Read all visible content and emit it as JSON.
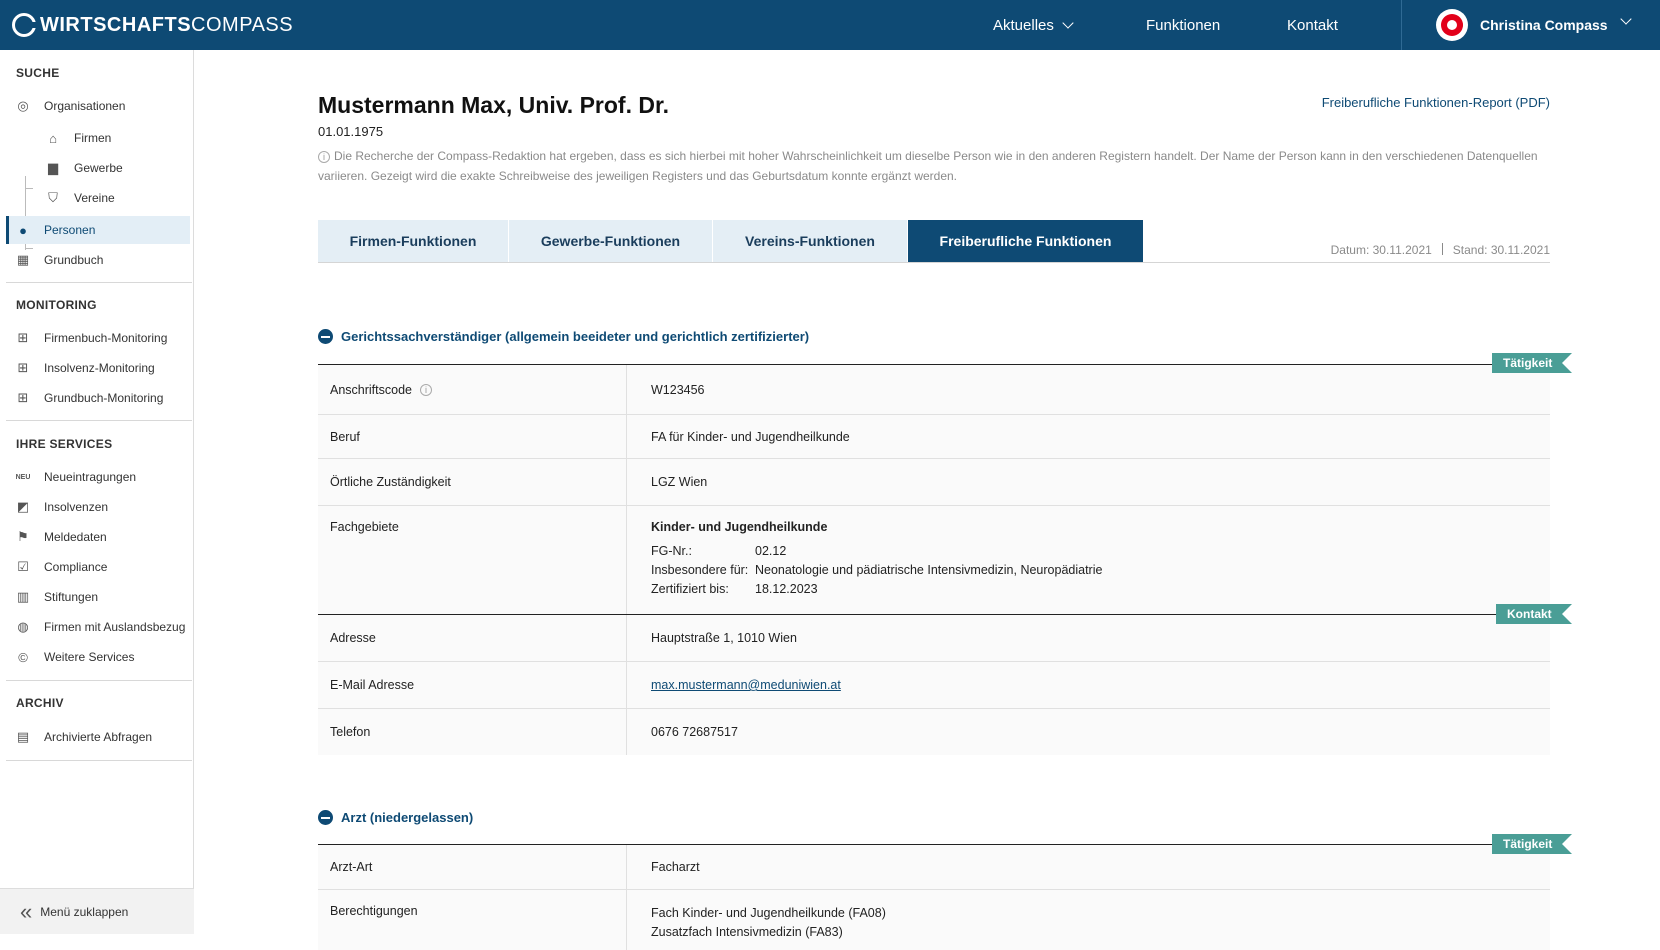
{
  "header": {
    "logo_bold": "WIRTSCHAFTS",
    "logo_light": "COMPASS",
    "nav": [
      "Aktuelles",
      "Funktionen",
      "Kontakt"
    ],
    "user": "Christina Compass"
  },
  "sidebar": {
    "sections": {
      "suche": "SUCHE",
      "monitoring": "MONITORING",
      "services": "IHRE SERVICES",
      "archiv": "ARCHIV"
    },
    "suche_items": [
      "Organisationen",
      "Firmen",
      "Gewerbe",
      "Vereine",
      "Personen",
      "Grundbuch"
    ],
    "monitoring_items": [
      "Firmenbuch-Monitoring",
      "Insolvenz-Monitoring",
      "Grundbuch-Monitoring"
    ],
    "services_items": [
      "Neueintragungen",
      "Insolvenzen",
      "Meldedaten",
      "Compliance",
      "Stiftungen",
      "Firmen mit Auslandsbezug",
      "Weitere Services"
    ],
    "neu_badge": "NEU",
    "archiv_items": [
      "Archivierte Abfragen"
    ],
    "collapse": "Menü zuklappen"
  },
  "main": {
    "title": "Mustermann Max, Univ. Prof. Dr.",
    "dob": "01.01.1975",
    "pdf_link": "Freiberufliche Funktionen-Report (PDF)",
    "info": "Die Recherche der Compass-Redaktion hat ergeben, dass es sich hierbei mit hoher Wahrscheinlichkeit um dieselbe Person wie in den anderen Registern handelt. Der Name der Person kann in den verschiedenen Datenquellen variieren. Gezeigt wird die exakte Schreibweise des jeweiligen Registers und das Geburtsdatum konnte ergänzt werden.",
    "tabs": [
      "Firmen-Funktionen",
      "Gewerbe-Funktionen",
      "Vereins-Funktionen",
      "Freiberufliche Funktionen"
    ],
    "datum": "Datum: 30.11.2021",
    "stand": "Stand: 30.11.2021"
  },
  "section1": {
    "title": "Gerichtssachverständiger (allgemein beeideter und gerichtlich zertifizierter)",
    "ribbon_taetigkeit": "Tätigkeit",
    "ribbon_kontakt": "Kontakt",
    "anschriftscode_label": "Anschriftscode",
    "anschriftscode": "W123456",
    "beruf_label": "Beruf",
    "beruf": "FA für Kinder- und Jugendheilkunde",
    "zustaendigkeit_label": "Örtliche Zuständigkeit",
    "zustaendigkeit": "LGZ Wien",
    "fachgebiete_label": "Fachgebiete",
    "fg_title": "Kinder- und Jugendheilkunde",
    "fg_nr_label": "FG-Nr.:",
    "fg_nr": "02.12",
    "insbesondere_label": "Insbesondere für:",
    "insbesondere": "Neonatologie und pädiatrische Intensivmedizin, Neuropädiatrie",
    "zertifiziert_label": "Zertifiziert bis:",
    "zertifiziert": "18.12.2023",
    "adresse_label": "Adresse",
    "adresse": "Hauptstraße 1, 1010 Wien",
    "email_label": "E-Mail Adresse",
    "email": "max.mustermann@meduniwien.at",
    "telefon_label": "Telefon",
    "telefon": "0676 72687517"
  },
  "section2": {
    "title": "Arzt (niedergelassen)",
    "ribbon_taetigkeit": "Tätigkeit",
    "arztart_label": "Arzt-Art",
    "arztart": "Facharzt",
    "berechtigungen_label": "Berechtigungen",
    "berechtigung1": "Fach Kinder- und Jugendheilkunde (FA08)",
    "berechtigung2": "Zusatzfach Intensivmedizin (FA83)"
  }
}
